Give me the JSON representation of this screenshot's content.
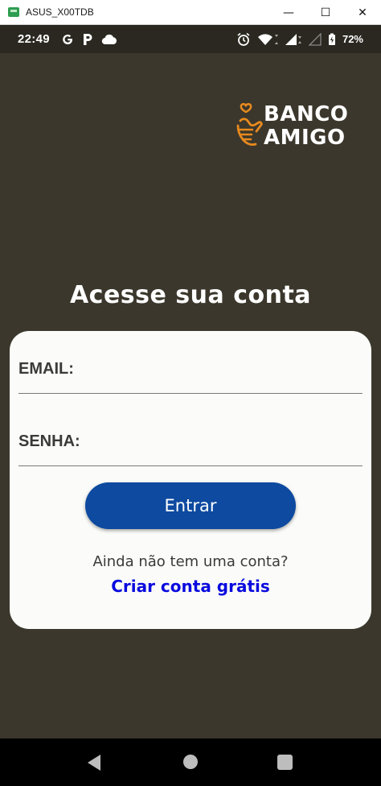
{
  "window": {
    "title": "ASUS_X00TDB",
    "minimize_glyph": "—",
    "maximize_glyph": "☐",
    "close_glyph": "✕"
  },
  "status_bar": {
    "time": "22:49",
    "left_icons": [
      "google-icon",
      "p-icon",
      "cloud-icon"
    ],
    "right_icons": [
      "alarm-icon",
      "wifi-icon",
      "signal-icon",
      "signal-empty-icon",
      "battery-icon"
    ],
    "battery": "72%"
  },
  "logo": {
    "line1": "BANCO",
    "line2": "AMIGO",
    "icon": "hand-heart-icon",
    "icon_color": "#e88a1e"
  },
  "heading": "Acesse sua conta",
  "form": {
    "email_label": "EMAIL:",
    "email_value": "",
    "password_label": "SENHA:",
    "password_value": "",
    "submit_label": "Entrar",
    "no_account_text": "Ainda não tem uma conta?",
    "create_account_link": "Criar conta grátis"
  },
  "colors": {
    "background": "#3b372c",
    "card": "#fbfcf9",
    "button": "#0d4aa0",
    "link": "#0a0adf"
  },
  "nav_bar": {
    "buttons": [
      "back-icon",
      "home-icon",
      "recent-apps-icon"
    ]
  }
}
